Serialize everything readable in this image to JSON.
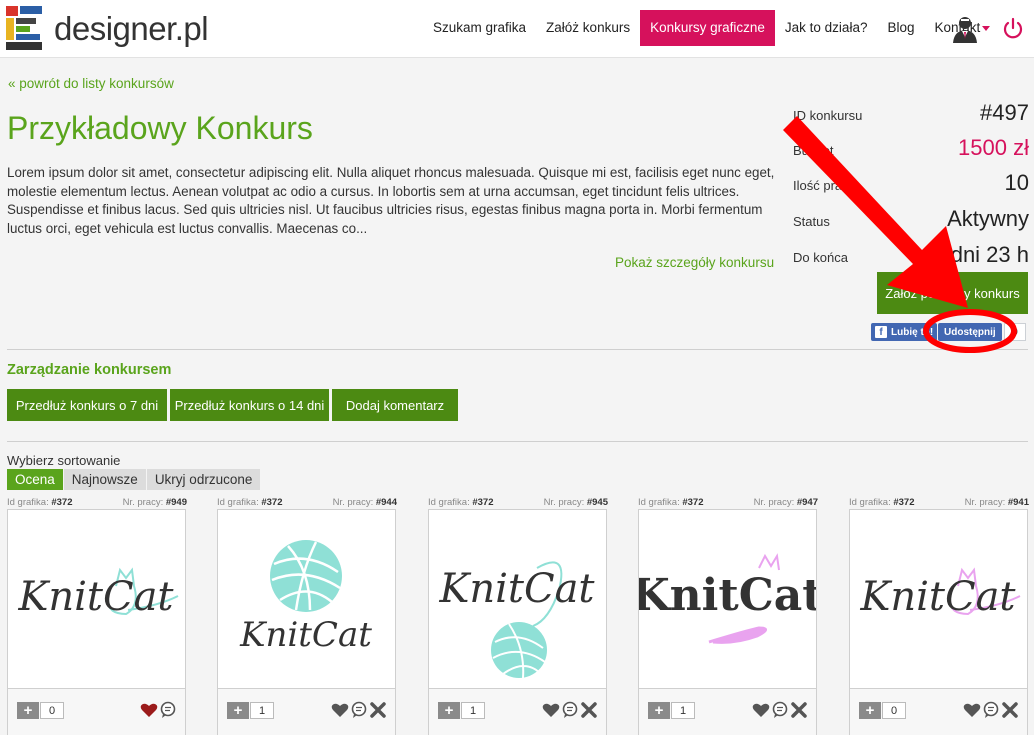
{
  "header": {
    "logo_text": "designer.pl",
    "nav": [
      {
        "label": "Szukam grafika",
        "active": false
      },
      {
        "label": "Załóż konkurs",
        "active": false
      },
      {
        "label": "Konkursy graficzne",
        "active": true
      },
      {
        "label": "Jak to działa?",
        "active": false
      },
      {
        "label": "Blog",
        "active": false
      },
      {
        "label": "Kontakt",
        "active": false
      }
    ],
    "user_icon": "user-avatar-icon",
    "power_icon": "power-icon"
  },
  "contest": {
    "back_link": "« powrót do listy konkursów",
    "title": "Przykładowy Konkurs",
    "description": "Lorem ipsum dolor sit amet, consectetur adipiscing elit. Nulla aliquet rhoncus malesuada. Quisque mi est, facilisis eget nunc eget, molestie elementum lectus. Aenean volutpat ac odio a cursus. In lobortis sem at urna accumsan, eget tincidunt felis ultrices. Suspendisse et finibus lacus. Sed quis ultricies nisl. Ut faucibus ultricies risus, egestas finibus magna porta in. Morbi fermentum luctus orci, eget vehicula est luctus convallis. Maecenas co...",
    "details_link": "Pokaż szczegóły konkursu"
  },
  "info": {
    "id_label": "ID konkursu",
    "id_value": "#497",
    "budget_label": "Budżet",
    "budget_value": "1500 zł",
    "count_label": "Ilość prac",
    "count_value": "10",
    "status_label": "Status",
    "status_value": "Aktywny",
    "end_label": "Do końca",
    "end_value": "6 dni 23 h",
    "similar_button": "Załóż podobny konkurs",
    "fb_like": "Lubię to!",
    "fb_share": "Udostępnij",
    "fb_count": "0"
  },
  "manage": {
    "title": "Zarządzanie konkursem",
    "buttons": [
      "Przedłuż konkurs o 7 dni",
      "Przedłuż konkurs o 14 dni",
      "Dodaj komentarz"
    ]
  },
  "sort": {
    "label": "Wybierz sortowanie",
    "tabs": [
      {
        "label": "Ocena",
        "active": true
      },
      {
        "label": "Najnowsze",
        "active": false
      },
      {
        "label": "Ukryj odrzucone",
        "active": false
      }
    ]
  },
  "works": {
    "designer_label": "Id grafika:",
    "work_label": "Nr. pracy:",
    "items": [
      {
        "designer_id": "#372",
        "work_no": "#949",
        "votes": "0",
        "logo_text": "KnitCat",
        "liked": true,
        "accent": "#8fe0d6"
      },
      {
        "designer_id": "#372",
        "work_no": "#944",
        "votes": "1",
        "logo_text": "KnitCat",
        "liked": false,
        "accent": "#8fe0d6"
      },
      {
        "designer_id": "#372",
        "work_no": "#945",
        "votes": "1",
        "logo_text": "KnitCat",
        "liked": false,
        "accent": "#8fe0d6"
      },
      {
        "designer_id": "#372",
        "work_no": "#947",
        "votes": "1",
        "logo_text": "KnitCat",
        "liked": false,
        "accent": "#e9a3ef"
      },
      {
        "designer_id": "#372",
        "work_no": "#941",
        "votes": "0",
        "logo_text": "KnitCat",
        "liked": false,
        "accent": "#e9a3ef"
      }
    ]
  },
  "colors": {
    "brand_green": "#5aa41c",
    "button_green": "#4c8a12",
    "accent_pink": "#d6115c",
    "annotation_red": "#ff0000"
  }
}
